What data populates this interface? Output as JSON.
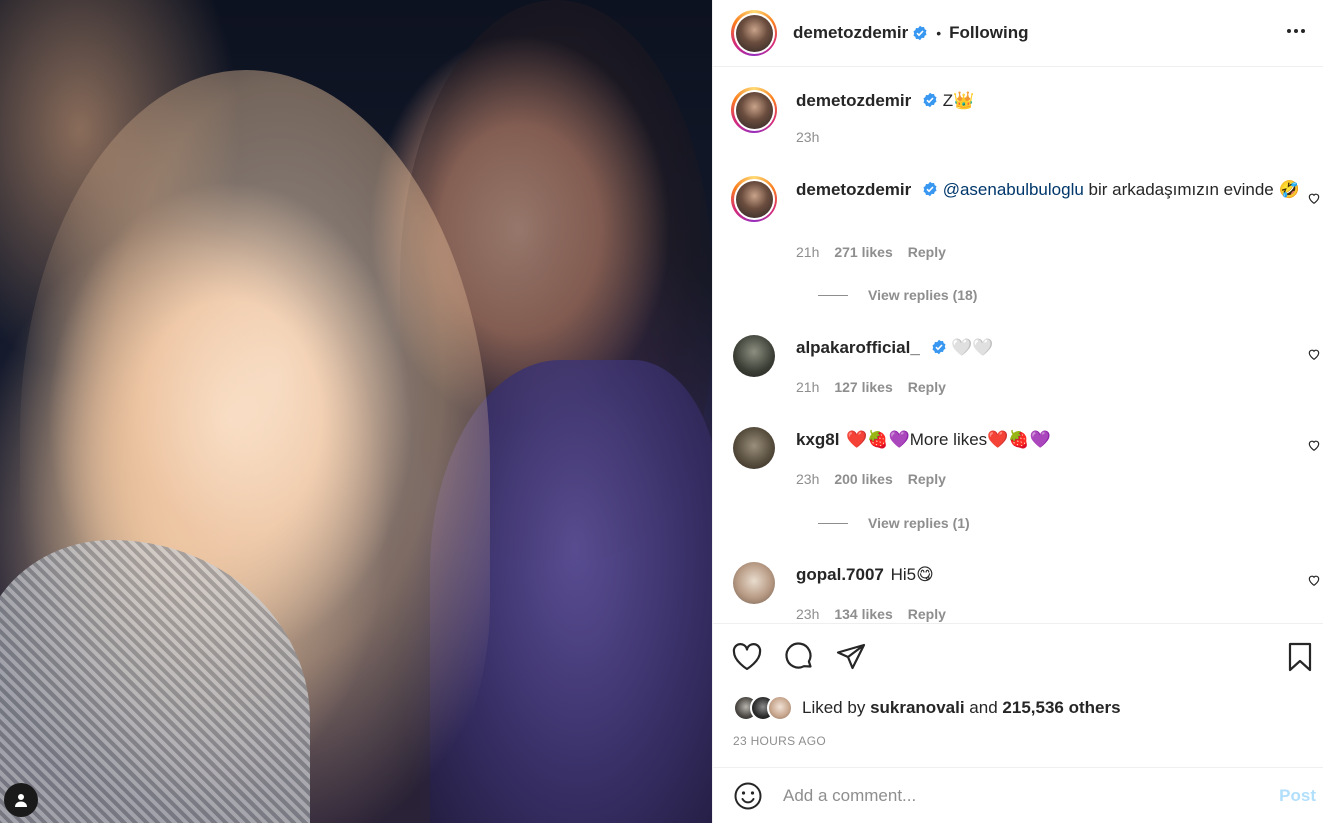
{
  "header": {
    "username": "demetozdemir",
    "separator": "•",
    "follow_status": "Following"
  },
  "caption": {
    "username": "demetozdemir",
    "text": "Z👑",
    "time": "23h"
  },
  "comments": [
    {
      "username": "demetozdemir",
      "mention": "@asenabulbuloglu",
      "text": " bir arkadaşımızın evinde 🤣",
      "time": "21h",
      "likes": "271 likes",
      "reply": "Reply",
      "view_replies": "View replies (18)"
    },
    {
      "username": "alpakarofficial_",
      "text": "🤍🤍",
      "time": "21h",
      "likes": "127 likes",
      "reply": "Reply"
    },
    {
      "username": "kxg8l",
      "text": "❤️🍓💜More likes❤️🍓💜",
      "time": "23h",
      "likes": "200 likes",
      "reply": "Reply",
      "view_replies": "View replies (1)"
    },
    {
      "username": "gopal.7007",
      "text": "Hi5😋",
      "time": "23h",
      "likes": "134 likes",
      "reply": "Reply"
    }
  ],
  "likes": {
    "prefix": "Liked by",
    "user": "sukranovali",
    "middle": "and",
    "others": "215,536 others"
  },
  "post_time": "23 HOURS AGO",
  "add_comment": {
    "placeholder": "Add a comment...",
    "post_label": "Post"
  },
  "colors": {
    "verified": "#3897f0",
    "link": "#00376b",
    "post_disabled": "#b2dffc",
    "muted": "#8e8e8e"
  },
  "icons": [
    "heart-icon",
    "comment-icon",
    "share-icon",
    "bookmark-icon",
    "emoji-icon",
    "more-icon",
    "verified-icon",
    "user-tag-icon"
  ]
}
